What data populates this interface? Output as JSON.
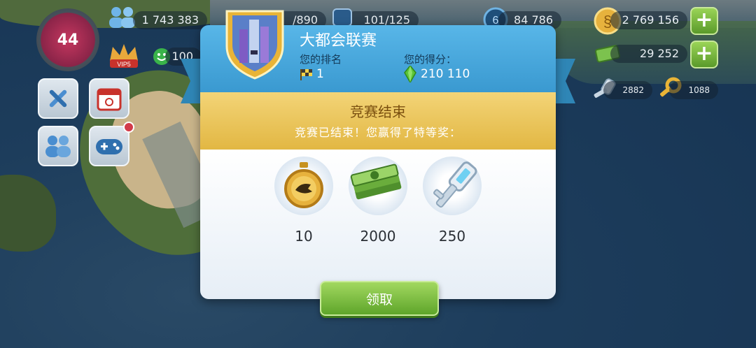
{
  "hud": {
    "level": "44",
    "population": "1 743 383",
    "happiness": "100",
    "resource_count": "/890",
    "storage": "101/125",
    "coins_small": "84 786",
    "simoleons": "2 769 156",
    "simcash": "29 252",
    "silver_keys": "2882",
    "golden_keys": "1088",
    "vip_label": "VIP5"
  },
  "modal": {
    "title": "大都会联赛",
    "rank_label": "您的排名",
    "rank_value": "1",
    "score_label": "您的得分：",
    "score_value": "210 110",
    "banner_title": "竞赛结束",
    "banner_sub": "竞赛已结束！您赢得了特等奖：",
    "rewards": [
      {
        "icon": "speedup-token-icon",
        "value": "10"
      },
      {
        "icon": "simcash-bills-icon",
        "value": "2000"
      },
      {
        "icon": "silver-key-icon",
        "value": "250"
      }
    ],
    "claim_label": "领取"
  },
  "colors": {
    "header_blue": "#3a99d0",
    "banner_gold": "#e2b743",
    "button_green": "#5ea52a"
  }
}
